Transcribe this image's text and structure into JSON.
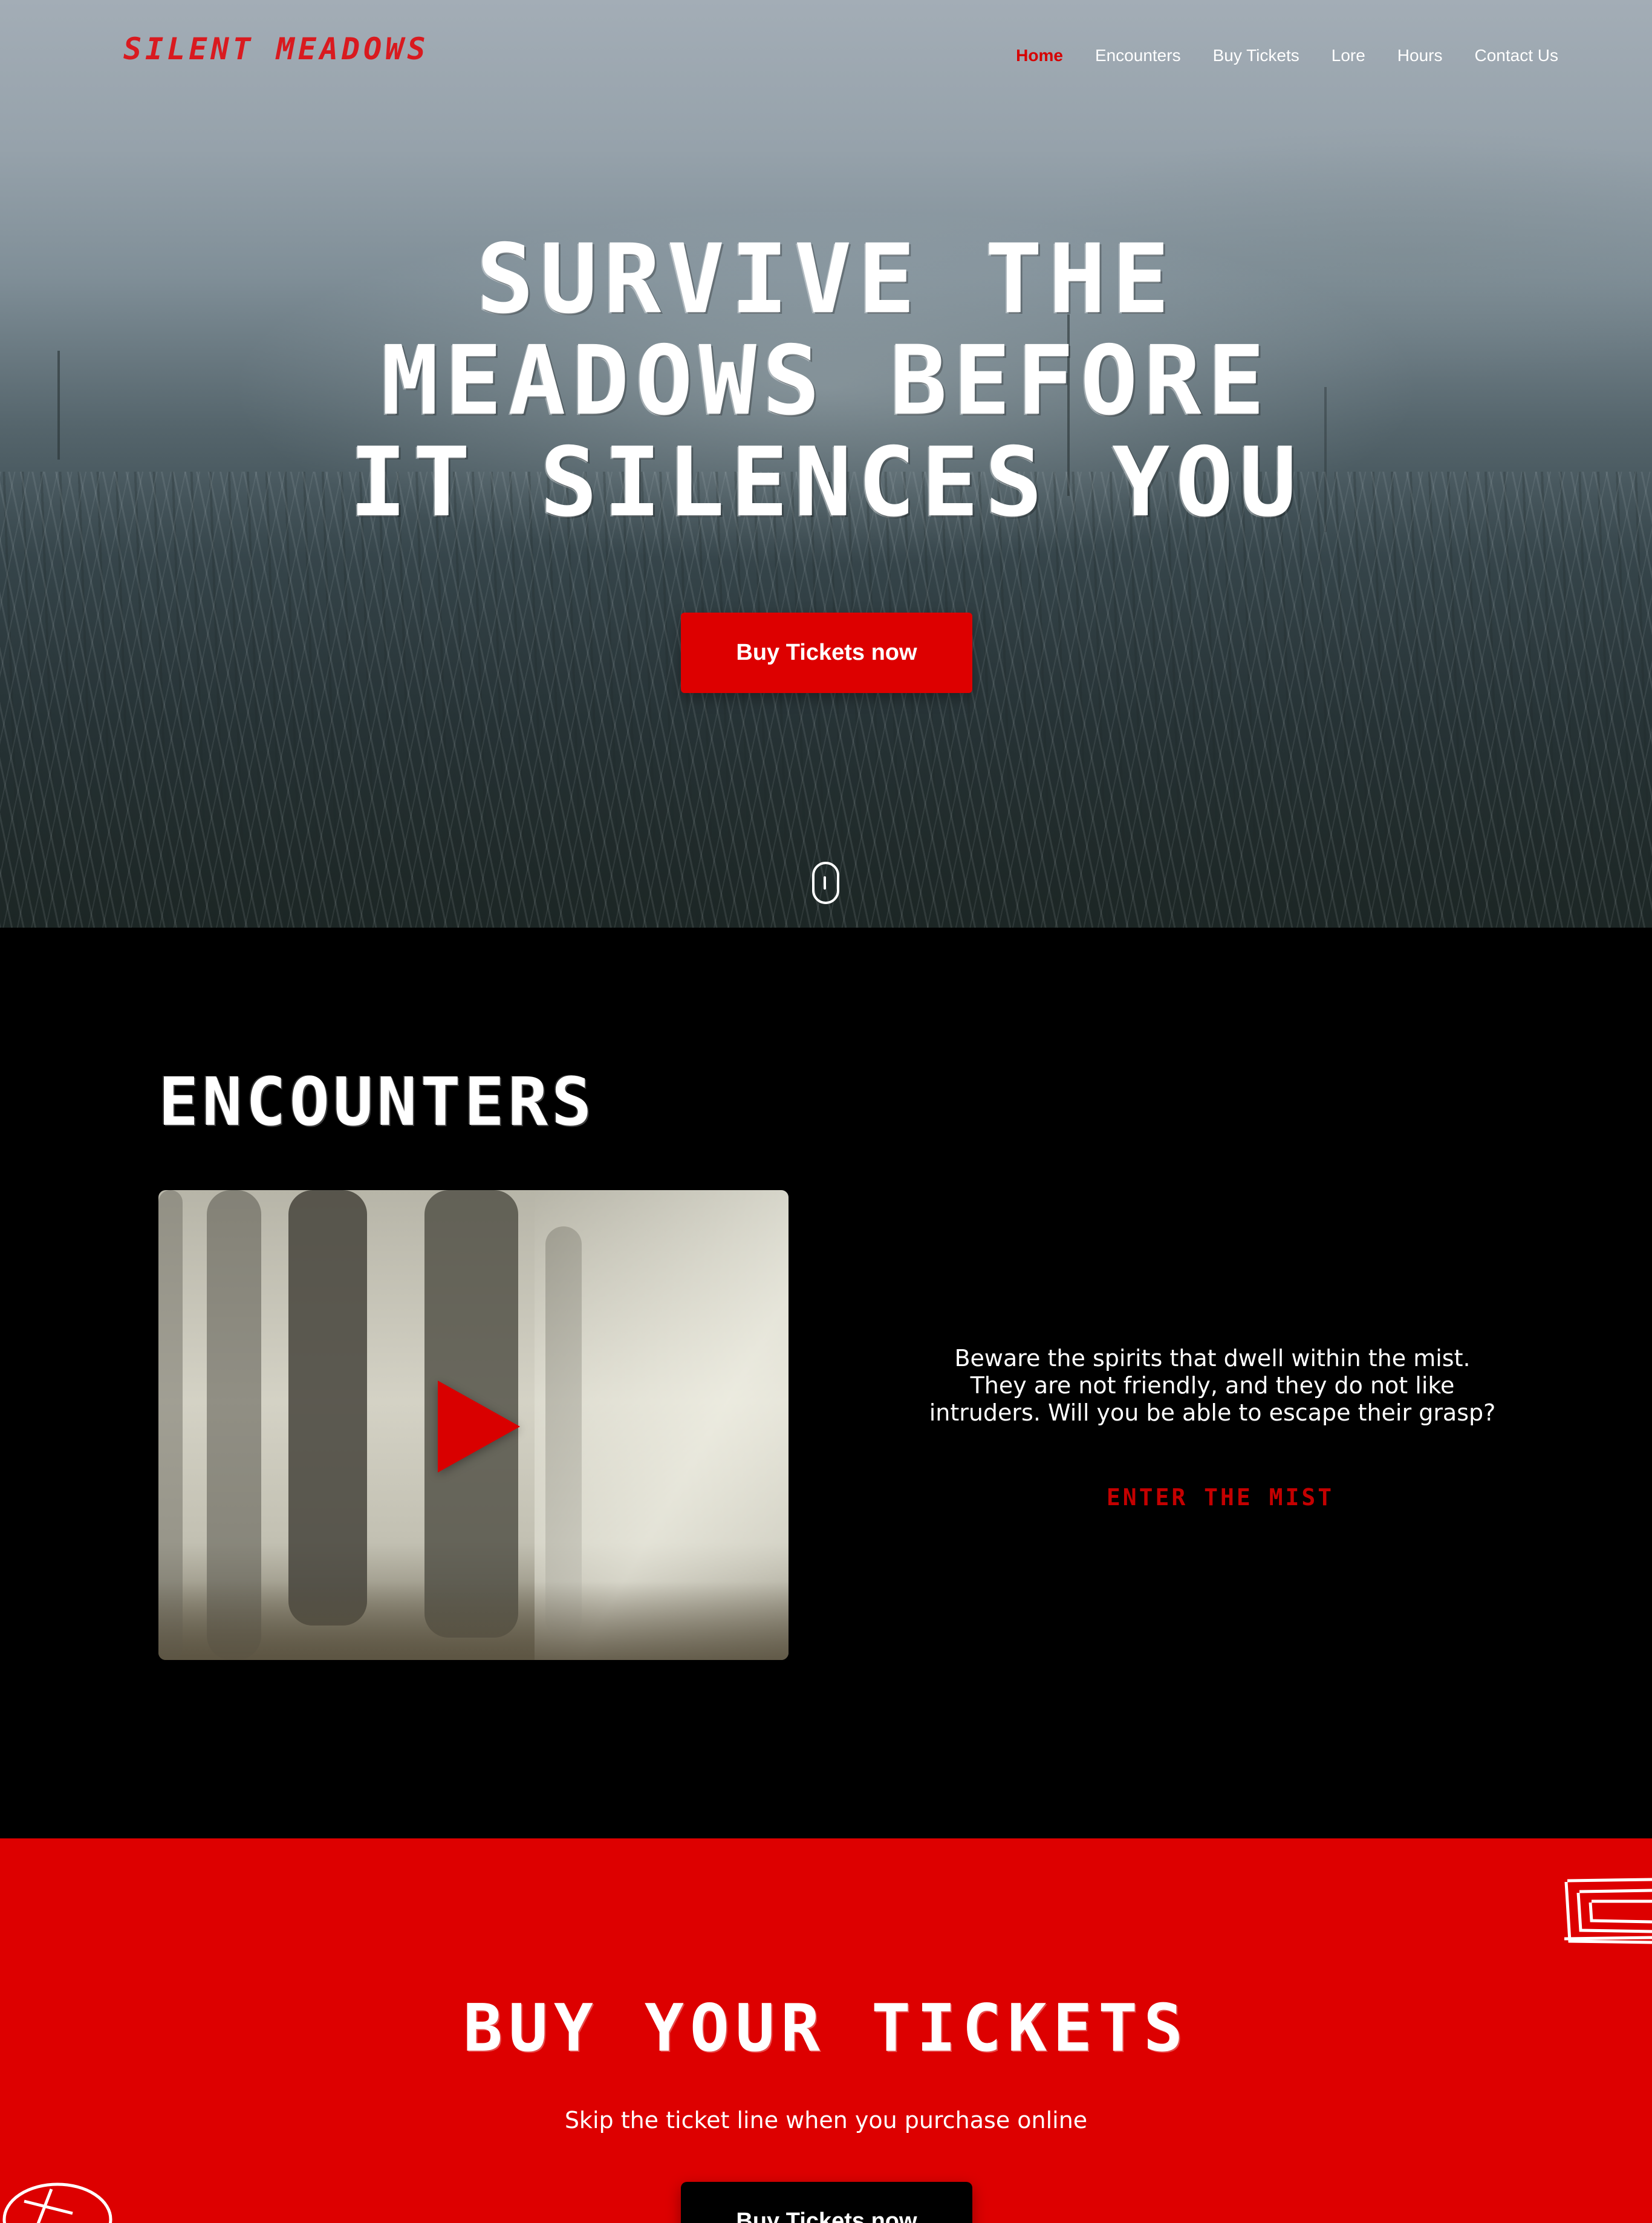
{
  "brand": {
    "logo_text": "SILENT MEADOWS",
    "accent_color": "#dd0000"
  },
  "nav": {
    "items": [
      {
        "label": "Home",
        "active": true
      },
      {
        "label": "Encounters",
        "active": false
      },
      {
        "label": "Buy Tickets",
        "active": false
      },
      {
        "label": "Lore",
        "active": false
      },
      {
        "label": "Hours",
        "active": false
      },
      {
        "label": "Contact Us",
        "active": false
      }
    ]
  },
  "hero": {
    "headline_line1": "SURVIVE THE",
    "headline_line2": "MEADOWS BEFORE",
    "headline_line3": "IT SILENCES YOU",
    "cta_label": "Buy Tickets now",
    "scroll_icon": "mouse-scroll-icon"
  },
  "encounters": {
    "title": "ENCOUNTERS",
    "video_icon": "play-icon",
    "description": "Beware the spirits that dwell within the mist. They are not friendly, and they do not like intruders. Will you be able to escape their grasp?",
    "link_label": "ENTER THE MIST"
  },
  "tickets": {
    "title": "BUY YOUR TICKETS",
    "subtitle": "Skip the ticket line when you purchase online",
    "cta_label": "Buy Tickets now",
    "background_color": "#dd0000",
    "button_color": "#000000"
  }
}
